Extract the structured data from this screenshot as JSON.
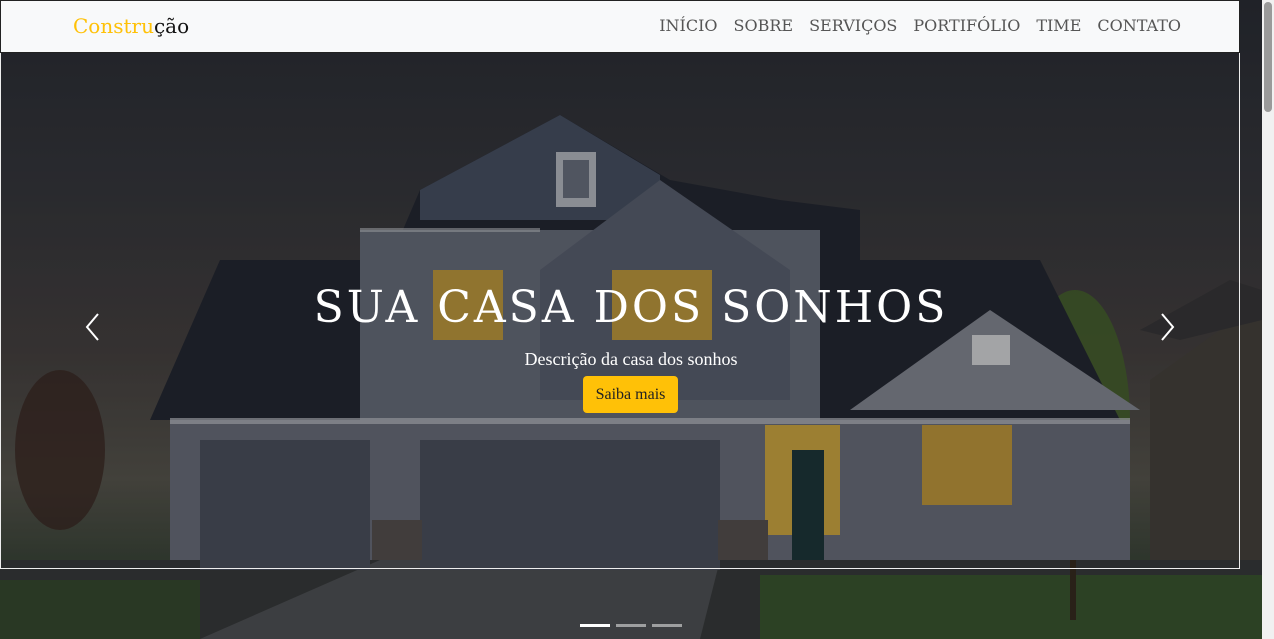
{
  "brand": {
    "accent": "Constru",
    "rest": "ção"
  },
  "nav": {
    "items": [
      {
        "label": "INÍCIO"
      },
      {
        "label": "SOBRE"
      },
      {
        "label": "SERVIÇOS"
      },
      {
        "label": "PORTIFÓLIO"
      },
      {
        "label": "TIME"
      },
      {
        "label": "CONTATO"
      }
    ]
  },
  "hero": {
    "title": "SUA CASA DOS SONHOS",
    "description": "Descrição da casa dos sonhos",
    "cta_label": "Saiba mais",
    "prev_icon": "chevron-left-icon",
    "next_icon": "chevron-right-icon",
    "slides_total": 3,
    "active_slide": 1
  },
  "colors": {
    "accent": "#ffc107",
    "navbar_bg": "#f8f9fa",
    "nav_text": "#555555"
  }
}
